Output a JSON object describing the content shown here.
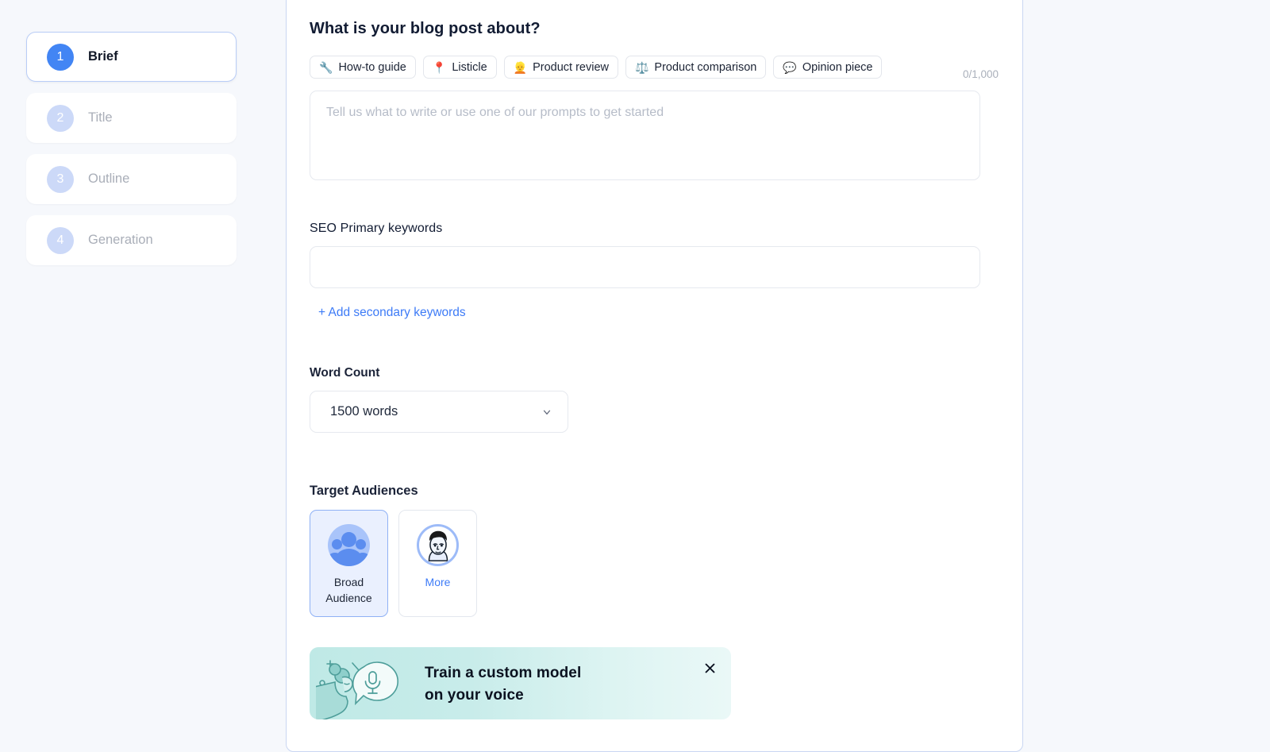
{
  "sidebar": {
    "steps": [
      {
        "number": "1",
        "label": "Brief",
        "state": "active"
      },
      {
        "number": "2",
        "label": "Title",
        "state": "inactive"
      },
      {
        "number": "3",
        "label": "Outline",
        "state": "inactive"
      },
      {
        "number": "4",
        "label": "Generation",
        "state": "inactive"
      }
    ]
  },
  "main": {
    "question": "What is your blog post about?",
    "prompt_chips": [
      {
        "emoji": "🔧",
        "label": "How-to guide",
        "icon": "wrench-icon"
      },
      {
        "emoji": "📍",
        "label": "Listicle",
        "icon": "pin-icon"
      },
      {
        "emoji": "👱",
        "label": "Product review",
        "icon": "person-icon"
      },
      {
        "emoji": "⚖️",
        "label": "Product comparison",
        "icon": "scales-icon"
      },
      {
        "emoji": "💬",
        "label": "Opinion piece",
        "icon": "speech-balloon-icon"
      }
    ],
    "brief": {
      "placeholder": "Tell us what to write or use one of our prompts to get started",
      "value": "",
      "counter": "0/1,000"
    },
    "seo": {
      "label": "SEO Primary keywords",
      "value": "",
      "add_secondary_label": "+ Add secondary keywords"
    },
    "word_count": {
      "label": "Word Count",
      "selected": "1500 words",
      "chevron": "chevron-down-icon"
    },
    "target_audiences": {
      "label": "Target Audiences",
      "items": [
        {
          "label": "Broad\nAudience",
          "line1": "Broad",
          "line2": "Audience",
          "icon": "group-avatar-icon",
          "selected": true
        },
        {
          "label": "More",
          "line1": "More",
          "line2": "",
          "icon": "face-avatar-icon",
          "selected": false
        }
      ]
    },
    "promo": {
      "line1": "Train a custom model",
      "line2": "on your voice",
      "close_icon": "close-icon",
      "art": "person-speaking-microphone-illustration"
    }
  },
  "colors": {
    "accent": "#4285f4",
    "link": "#3d7bf7",
    "page_bg": "#f6f8fc",
    "card_border": "#c9d6f2",
    "promo_start": "#bfe9e6",
    "promo_end": "#eaf8f7",
    "badge_inactive": "#ccd9f8"
  }
}
